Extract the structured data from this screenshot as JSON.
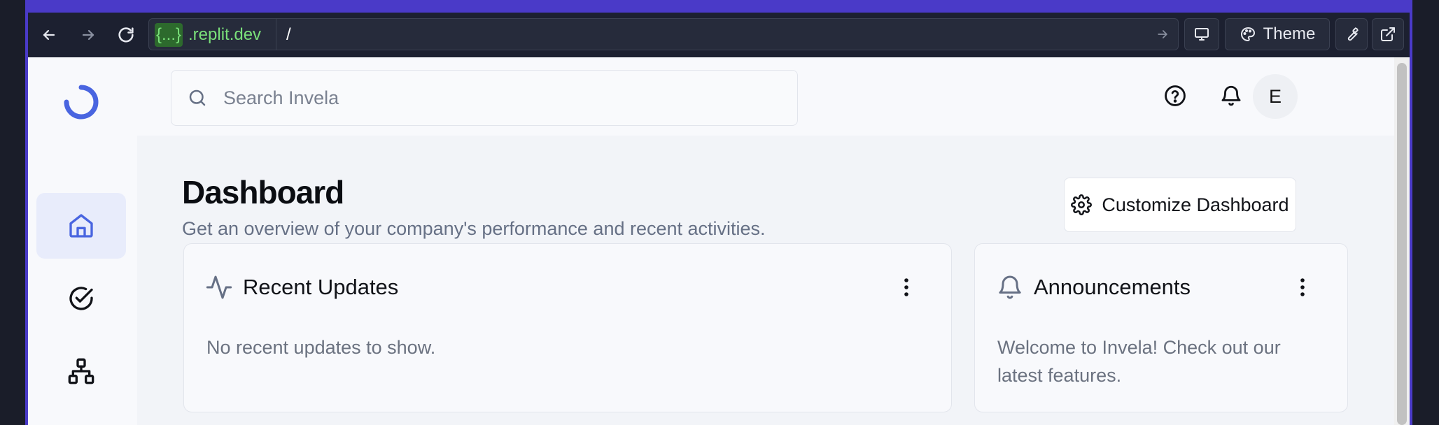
{
  "browser": {
    "url_host_highlight": "{...}",
    "url_host": ".replit.dev",
    "url_path": "/",
    "theme_label": "Theme"
  },
  "header": {
    "search_placeholder": "Search Invela",
    "avatar_initial": "E"
  },
  "sidebar": {
    "items": [
      {
        "name": "home",
        "icon": "home-icon",
        "active": true
      },
      {
        "name": "tasks",
        "icon": "check-circle-icon",
        "active": false
      },
      {
        "name": "network",
        "icon": "network-icon",
        "active": false
      }
    ]
  },
  "main": {
    "title": "Dashboard",
    "subtitle": "Get an overview of your company's performance and recent activities.",
    "customize_label": "Customize Dashboard",
    "cards": [
      {
        "title": "Recent Updates",
        "icon": "activity-icon",
        "body": "No recent updates to show."
      },
      {
        "title": "Announcements",
        "icon": "bell-icon",
        "body": "Welcome to Invela! Check out our latest features."
      }
    ]
  },
  "colors": {
    "accent": "#4a3ac8",
    "brand": "#4965e0",
    "url_green": "#7ae07a",
    "nav_active_bg": "#e8ecfb"
  }
}
